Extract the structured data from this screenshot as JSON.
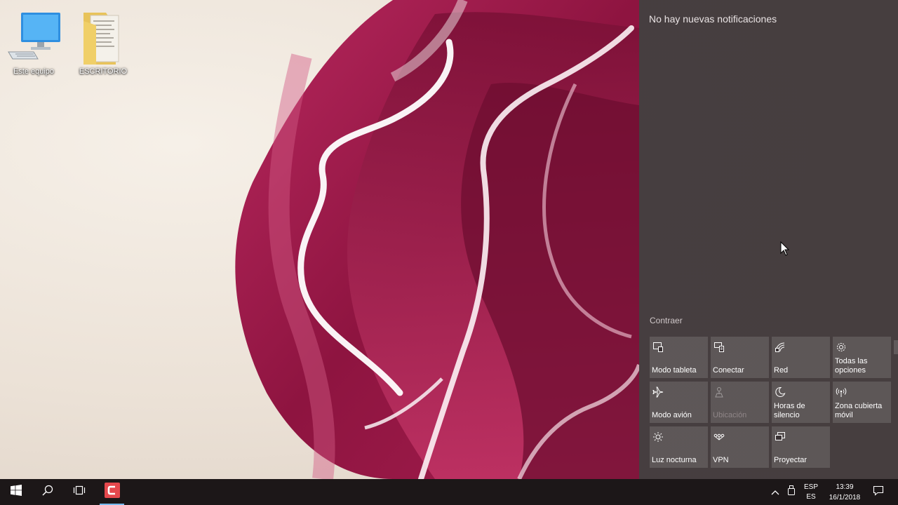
{
  "desktop": {
    "icons": [
      {
        "label": "Este equipo",
        "icon": "computer-icon"
      },
      {
        "label": "ESCRITORIO",
        "icon": "folder-icon"
      }
    ]
  },
  "action_center": {
    "no_notifications": "No hay nuevas notificaciones",
    "collapse": "Contraer",
    "tiles": [
      {
        "label": "Modo tableta",
        "icon": "tablet-mode-icon",
        "enabled": true
      },
      {
        "label": "Conectar",
        "icon": "connect-icon",
        "enabled": true
      },
      {
        "label": "Red",
        "icon": "network-icon",
        "enabled": true
      },
      {
        "label": "Todas las opciones",
        "icon": "gear-icon",
        "enabled": true
      },
      {
        "label": "Modo avión",
        "icon": "airplane-icon",
        "enabled": true
      },
      {
        "label": "Ubicación",
        "icon": "location-icon",
        "enabled": false
      },
      {
        "label": "Horas de silencio",
        "icon": "moon-icon",
        "enabled": true
      },
      {
        "label": "Zona cubierta móvil",
        "icon": "hotspot-icon",
        "enabled": true
      },
      {
        "label": "Luz nocturna",
        "icon": "sun-icon",
        "enabled": true
      },
      {
        "label": "VPN",
        "icon": "vpn-icon",
        "enabled": true
      },
      {
        "label": "Proyectar",
        "icon": "project-icon",
        "enabled": true
      }
    ]
  },
  "taskbar": {
    "language": {
      "line1": "ESP",
      "line2": "ES"
    },
    "clock": {
      "time": "13:39",
      "date": "16/1/2018"
    }
  },
  "colors": {
    "taskbar": "#1c1718",
    "action_center": "#3a3234",
    "wallpaper_accent": "#9c1b4a",
    "app_icon": "#e5484d",
    "active_underline": "#76b9ed"
  }
}
